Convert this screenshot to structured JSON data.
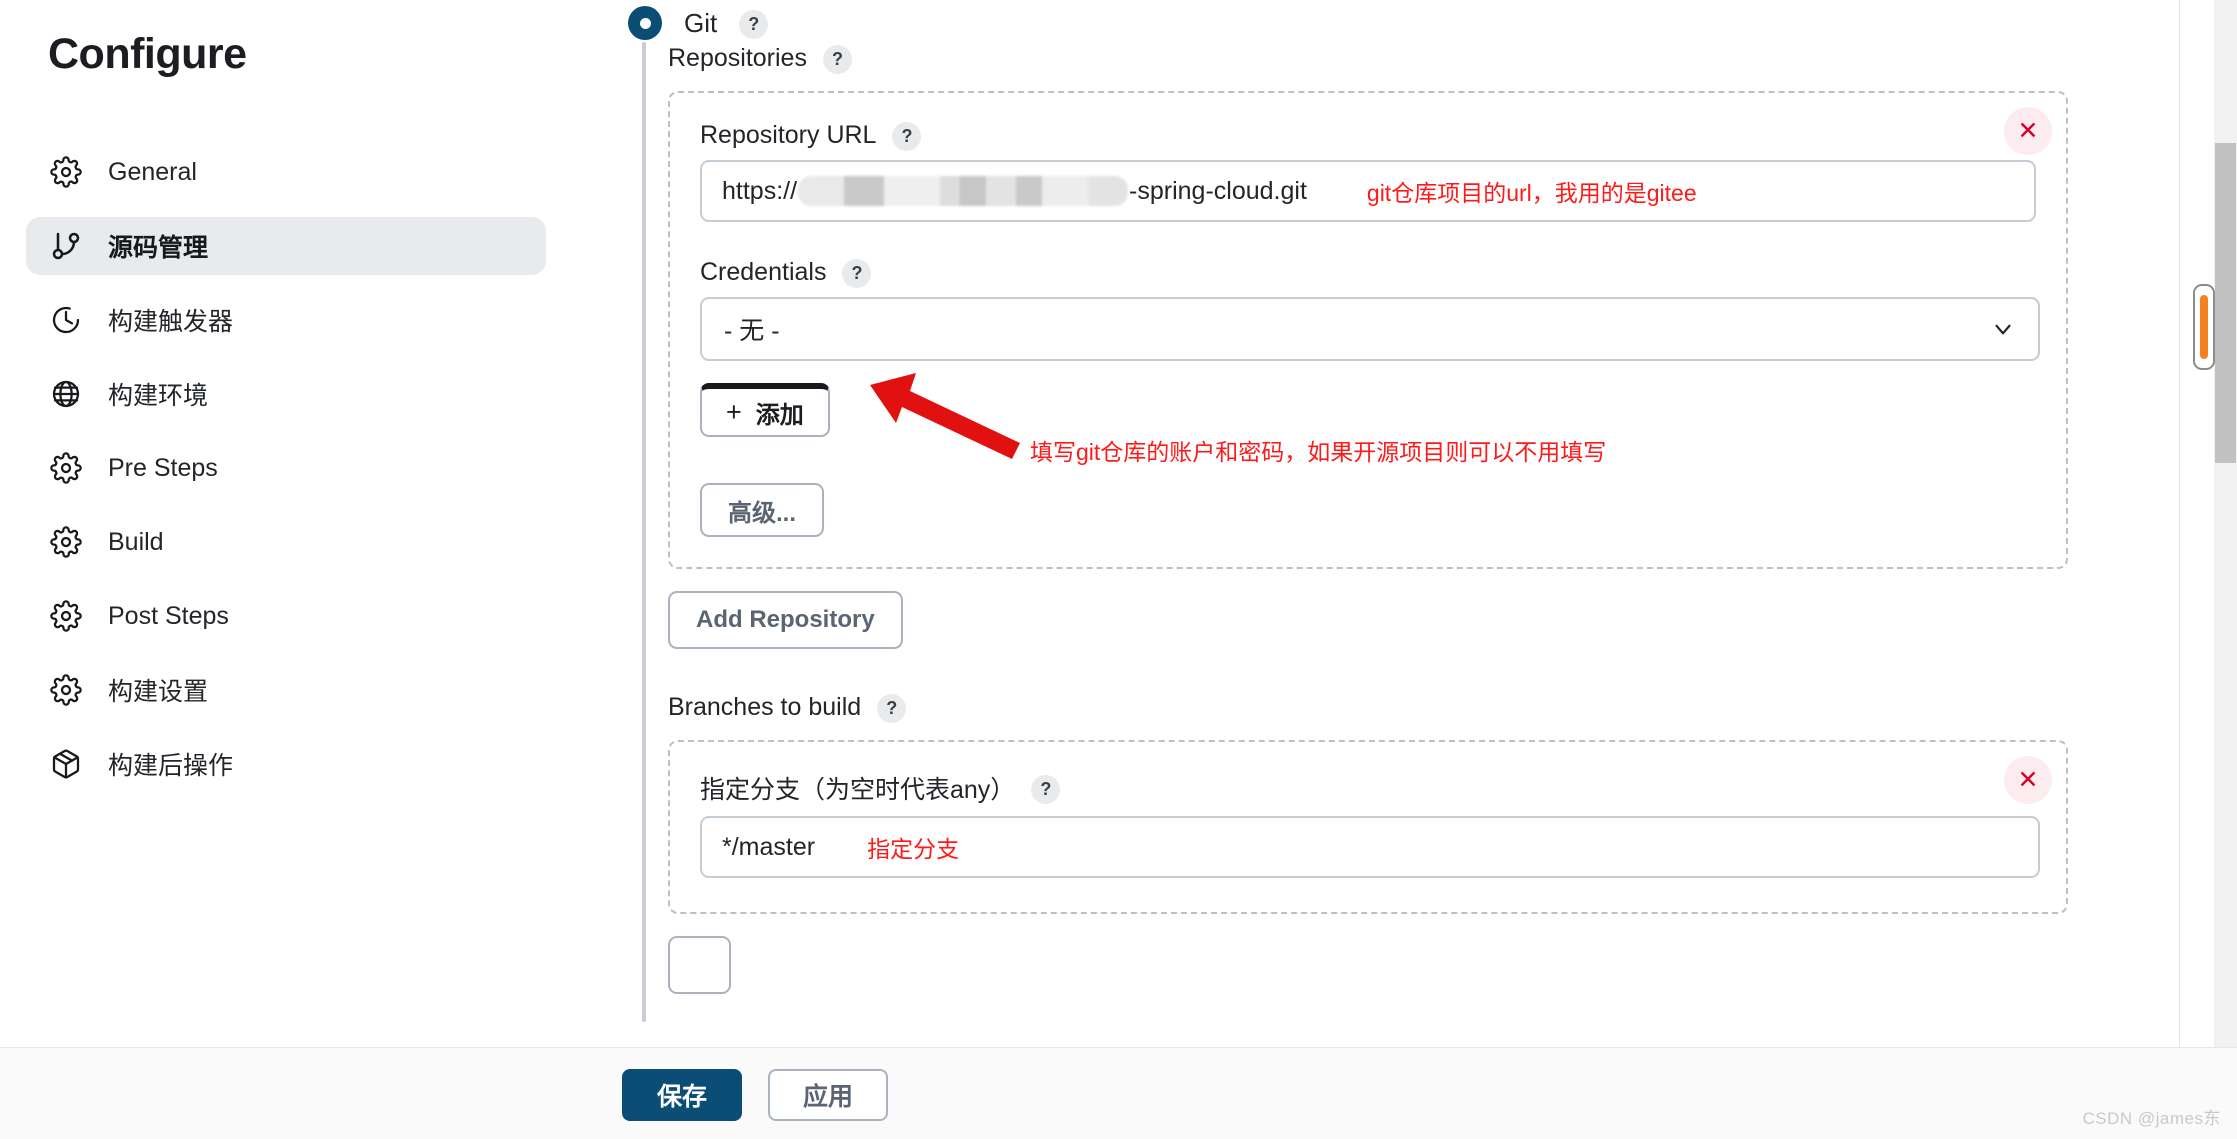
{
  "sidebar": {
    "title": "Configure",
    "items": [
      {
        "label": "General",
        "icon": "gear-icon",
        "active": false
      },
      {
        "label": "源码管理",
        "icon": "git-branch-icon",
        "active": true
      },
      {
        "label": "构建触发器",
        "icon": "clock-icon",
        "active": false
      },
      {
        "label": "构建环境",
        "icon": "globe-icon",
        "active": false
      },
      {
        "label": "Pre Steps",
        "icon": "gear-icon",
        "active": false
      },
      {
        "label": "Build",
        "icon": "gear-icon",
        "active": false
      },
      {
        "label": "Post Steps",
        "icon": "gear-icon",
        "active": false
      },
      {
        "label": "构建设置",
        "icon": "gear-icon",
        "active": false
      },
      {
        "label": "构建后操作",
        "icon": "package-icon",
        "active": false
      }
    ]
  },
  "scm": {
    "selected_label": "Git",
    "help_glyph": "?",
    "repositories_label": "Repositories",
    "repository": {
      "url_label": "Repository URL",
      "url_prefix": "https://",
      "url_suffix": "-spring-cloud.git",
      "url_annotation": "git仓库项目的url，我用的是gitee",
      "credentials_label": "Credentials",
      "credentials_value": "- 无 -",
      "add_credentials_label": "添加",
      "add_credentials_plus": "+",
      "credentials_annotation": "填写git仓库的账户和密码，如果开源项目则可以不用填写",
      "advanced_label": "高级...",
      "delete_glyph": "✕"
    },
    "add_repository_label": "Add Repository",
    "branches": {
      "section_label": "Branches to build",
      "branch_spec_label": "指定分支（为空时代表any）",
      "branch_value": "*/master",
      "branch_annotation": "指定分支",
      "delete_glyph": "✕"
    }
  },
  "footer": {
    "save_label": "保存",
    "apply_label": "应用",
    "watermark": "CSDN @james东"
  },
  "colors": {
    "accent": "#0b4d74",
    "annotation_red": "#ff1a1a",
    "delete_red": "#d6002a",
    "active_nav_bg": "#e8eaee",
    "orange": "#f58220"
  }
}
